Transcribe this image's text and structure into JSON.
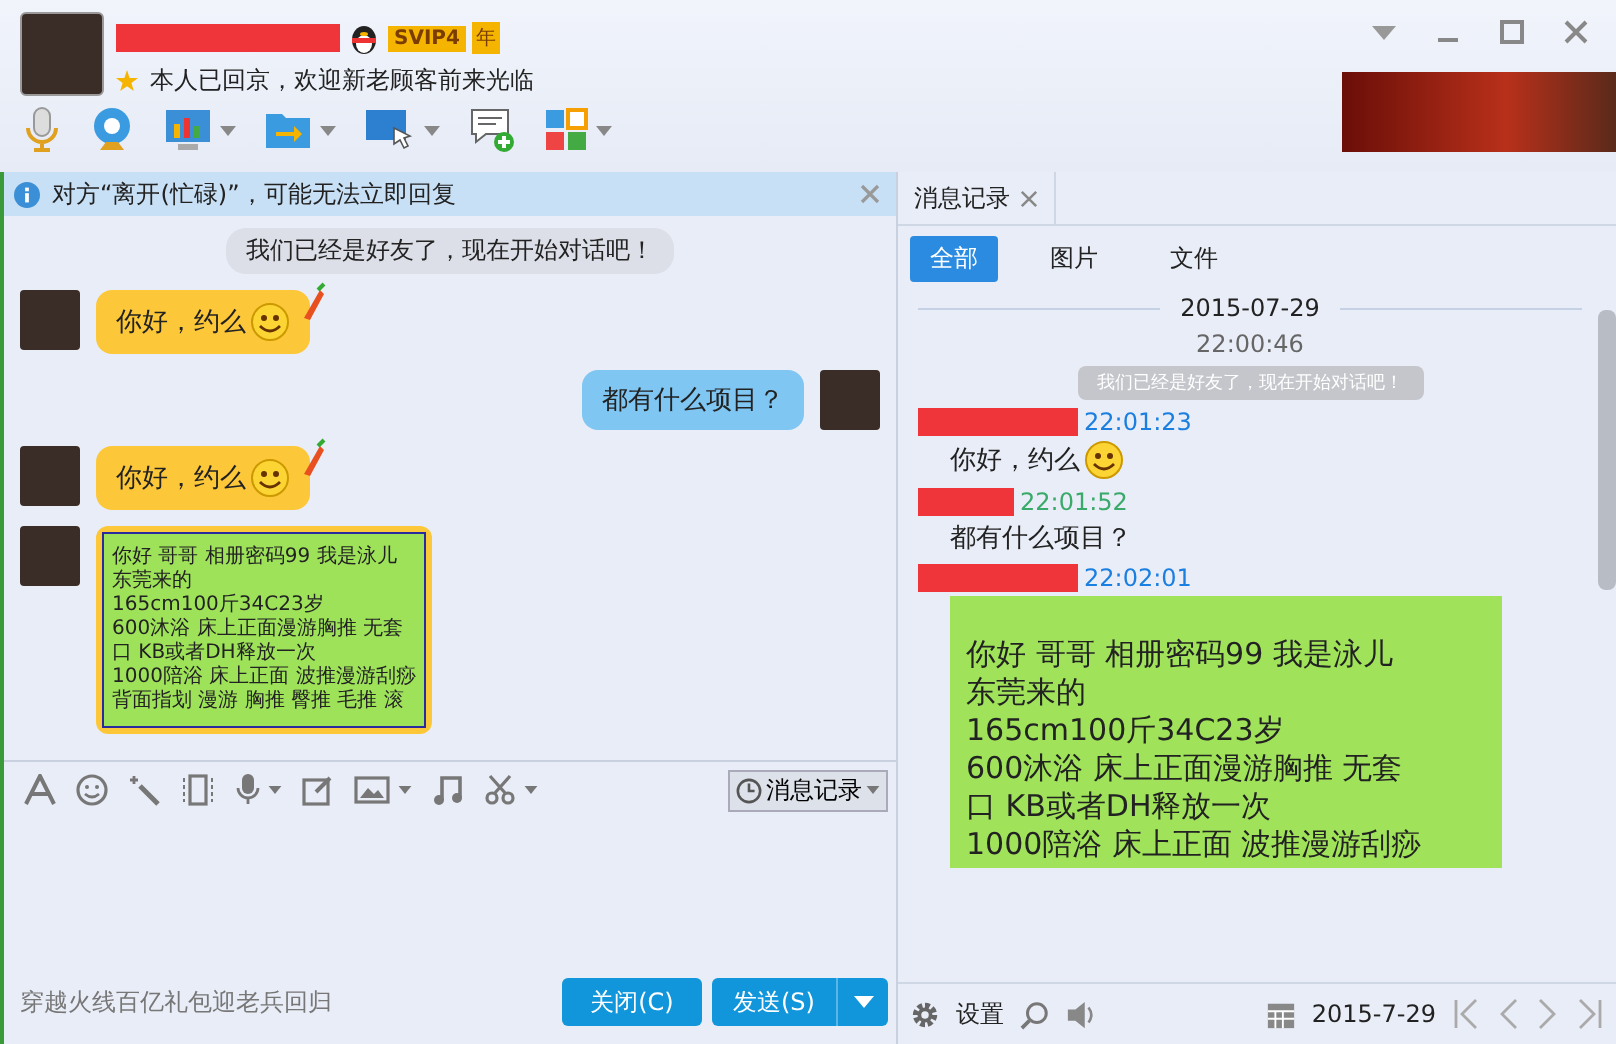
{
  "header": {
    "vip_badge": "SVIP4",
    "year_badge": "年",
    "status_text": "本人已回京，欢迎新老顾客前来光临"
  },
  "notice": {
    "text": "对方“离开(忙碌)”，可能无法立即回复"
  },
  "chat": [
    {
      "kind": "system",
      "lines": [
        "我们已经是好友了，现在开始对话吧！"
      ]
    },
    {
      "kind": "incoming",
      "lines": [
        "你好，约么"
      ],
      "emoji": true
    },
    {
      "kind": "outgoing",
      "lines": [
        "都有什么项目？"
      ],
      "emoji": false
    },
    {
      "kind": "incoming",
      "lines": [
        "你好，约么"
      ],
      "emoji": true
    },
    {
      "kind": "card",
      "lines": [
        "你好 哥哥 相册密码99 我是泳儿",
        "东莞来的",
        "165cm100斤34C23岁",
        "600沐浴 床上正面漫游胸推 无套",
        "口 KB或者DH释放一次",
        "1000陪浴 床上正面 波推漫游刮痧",
        "背面指划 漫游 胸推 臀推 毛推 滚"
      ]
    }
  ],
  "history_button": "消息记录",
  "input_hint": "穿越火线百亿礼包迎老兵回归",
  "buttons": {
    "close": "关闭(C)",
    "send": "发送(S)"
  },
  "history": {
    "tab": "消息记录",
    "filters": [
      {
        "label": "全部",
        "selected": true
      },
      {
        "label": "图片",
        "selected": false
      },
      {
        "label": "文件",
        "selected": false
      }
    ],
    "date": "2015-07-29",
    "time": "22:00:46",
    "system_text": "我们已经是好友了，现在开始对话吧！",
    "entries": [
      {
        "color": "#1a7fe0",
        "kind": "text",
        "time": "22:01:23",
        "lines": [
          "你好，约么"
        ],
        "emoji": true
      },
      {
        "color": "#3aaa6a",
        "kind": "text",
        "time": "22:01:52",
        "lines": [
          "都有什么项目？"
        ],
        "emoji": false
      },
      {
        "color": "#1a7fe0",
        "kind": "card",
        "time": "22:02:01",
        "lines": [
          "你好 哥哥 相册密码99 我是泳儿",
          "东莞来的",
          "165cm100斤34C23岁",
          "600沐浴 床上正面漫游胸推 无套",
          "口 KB或者DH释放一次",
          "1000陪浴 床上正面 波推漫游刮痧"
        ]
      }
    ]
  },
  "footer": {
    "settings": "设置",
    "date": "2015-7-29"
  }
}
